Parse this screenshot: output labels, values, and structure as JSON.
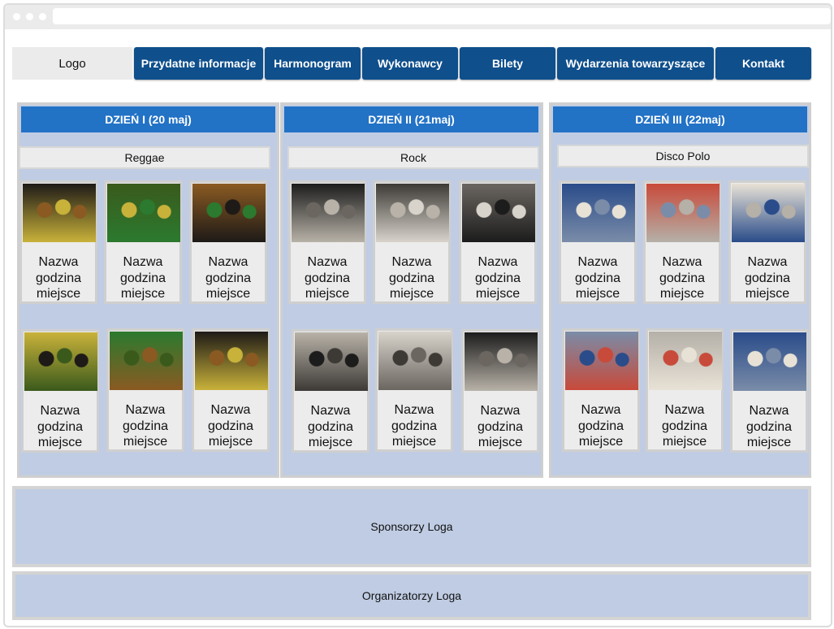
{
  "nav": {
    "logo": "Logo",
    "items": [
      "Przydatne informacje",
      "Harmonogram",
      "Wykonawcy",
      "Bilety",
      "Wydarzenia towarzyszące",
      "Kontakt"
    ]
  },
  "days": [
    {
      "title": "DZIEŃ I (20 maj)",
      "genre": "Reggae",
      "cards": [
        {
          "name": "Nazwa",
          "time": "godzina",
          "place": "miejsce",
          "photo": "reggae-band-photo"
        },
        {
          "name": "Nazwa",
          "time": "godzina",
          "place": "miejsce",
          "photo": "reggae-band-photo"
        },
        {
          "name": "Nazwa",
          "time": "godzina",
          "place": "miejsce",
          "photo": "reggae-band-photo"
        },
        {
          "name": "Nazwa",
          "time": "godzina",
          "place": "miejsce",
          "photo": "reggae-band-photo"
        },
        {
          "name": "Nazwa",
          "time": "godzina",
          "place": "miejsce",
          "photo": "reggae-band-photo"
        },
        {
          "name": "Nazwa",
          "time": "godzina",
          "place": "miejsce",
          "photo": "reggae-band-photo"
        }
      ]
    },
    {
      "title": "DZIEŃ II (21maj)",
      "genre": "Rock",
      "cards": [
        {
          "name": "Nazwa",
          "time": "godzina",
          "place": "miejsce",
          "photo": "rock-band-photo"
        },
        {
          "name": "Nazwa",
          "time": "godzina",
          "place": "miejsce",
          "photo": "rock-band-photo"
        },
        {
          "name": "Nazwa",
          "time": "godzina",
          "place": "miejsce",
          "photo": "rock-band-photo"
        },
        {
          "name": "Nazwa",
          "time": "godzina",
          "place": "miejsce",
          "photo": "rock-band-photo"
        },
        {
          "name": "Nazwa",
          "time": "godzina",
          "place": "miejsce",
          "photo": "rock-band-photo"
        },
        {
          "name": "Nazwa",
          "time": "godzina",
          "place": "miejsce",
          "photo": "rock-band-photo"
        }
      ]
    },
    {
      "title": "DZIEŃ III (22maj)",
      "genre": "Disco Polo",
      "cards": [
        {
          "name": "Nazwa",
          "time": "godzina",
          "place": "miejsce",
          "photo": "disco-polo-band-photo"
        },
        {
          "name": "Nazwa",
          "time": "godzina",
          "place": "miejsce",
          "photo": "disco-polo-band-photo"
        },
        {
          "name": "Nazwa",
          "time": "godzina",
          "place": "miejsce",
          "photo": "disco-polo-band-photo"
        },
        {
          "name": "Nazwa",
          "time": "godzina",
          "place": "miejsce",
          "photo": "disco-polo-band-photo"
        },
        {
          "name": "Nazwa",
          "time": "godzina",
          "place": "miejsce",
          "photo": "disco-polo-band-photo"
        },
        {
          "name": "Nazwa",
          "time": "godzina",
          "place": "miejsce",
          "photo": "disco-polo-band-photo"
        }
      ]
    }
  ],
  "sponsors": "Sponsorzy Loga",
  "organizers": "Organizatorzy Loga",
  "colors": {
    "nav_button": "#0f4f8c",
    "day_header": "#2272c6",
    "panel": "#bfcce3",
    "card": "#ececec"
  }
}
